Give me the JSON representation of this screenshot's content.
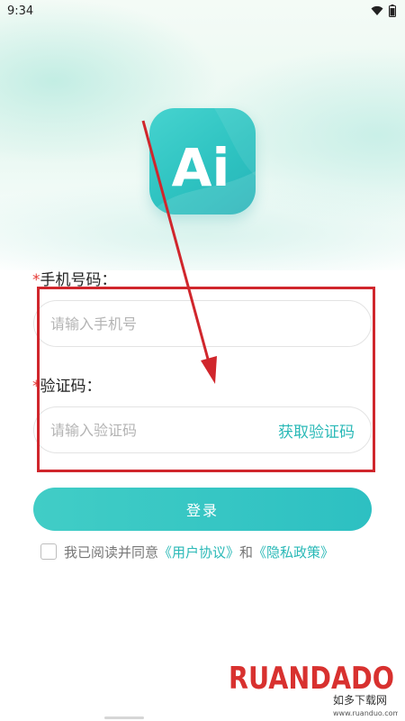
{
  "status_bar": {
    "time": "9:34"
  },
  "logo": {
    "text": "Ai"
  },
  "phone": {
    "required_mark": "*",
    "label": "手机号码：",
    "placeholder": "请输入手机号"
  },
  "code": {
    "required_mark": "*",
    "label": "验证码：",
    "placeholder": "请输入验证码",
    "get_code": "获取验证码"
  },
  "login": {
    "label": "登录"
  },
  "agreement": {
    "prefix": "我已阅读并同意",
    "user_agreement": "《用户协议》",
    "and": "和",
    "privacy_policy": "《隐私政策》"
  },
  "watermark": {
    "brand": "RUANDADO",
    "sub": "如多下载网",
    "url": "www.ruanduo.com"
  },
  "colors": {
    "accent": "#2ec3c1",
    "highlight": "#d0262c",
    "required": "#e53935"
  }
}
